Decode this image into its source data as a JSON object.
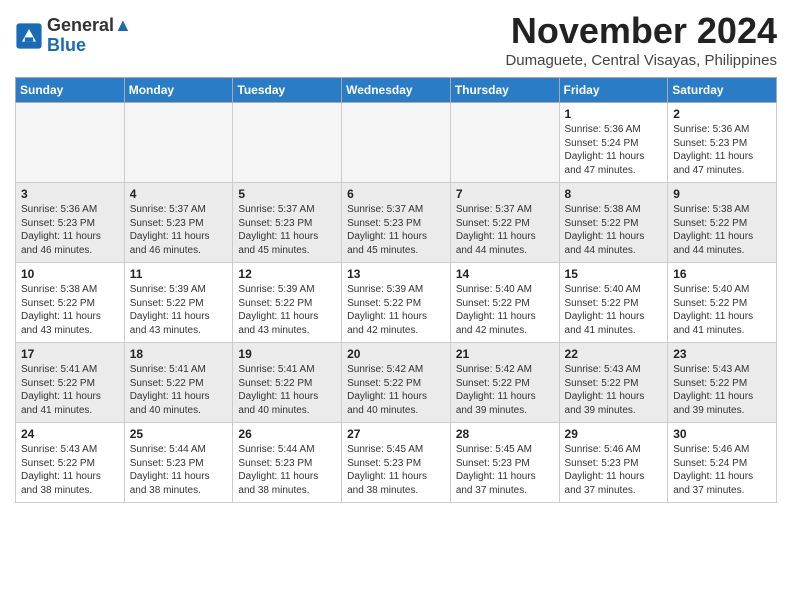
{
  "logo": {
    "line1": "General",
    "line2": "Blue"
  },
  "title": "November 2024",
  "location": "Dumaguete, Central Visayas, Philippines",
  "weekdays": [
    "Sunday",
    "Monday",
    "Tuesday",
    "Wednesday",
    "Thursday",
    "Friday",
    "Saturday"
  ],
  "weeks": [
    [
      {
        "day": "",
        "info": ""
      },
      {
        "day": "",
        "info": ""
      },
      {
        "day": "",
        "info": ""
      },
      {
        "day": "",
        "info": ""
      },
      {
        "day": "",
        "info": ""
      },
      {
        "day": "1",
        "info": "Sunrise: 5:36 AM\nSunset: 5:24 PM\nDaylight: 11 hours\nand 47 minutes."
      },
      {
        "day": "2",
        "info": "Sunrise: 5:36 AM\nSunset: 5:23 PM\nDaylight: 11 hours\nand 47 minutes."
      }
    ],
    [
      {
        "day": "3",
        "info": "Sunrise: 5:36 AM\nSunset: 5:23 PM\nDaylight: 11 hours\nand 46 minutes."
      },
      {
        "day": "4",
        "info": "Sunrise: 5:37 AM\nSunset: 5:23 PM\nDaylight: 11 hours\nand 46 minutes."
      },
      {
        "day": "5",
        "info": "Sunrise: 5:37 AM\nSunset: 5:23 PM\nDaylight: 11 hours\nand 45 minutes."
      },
      {
        "day": "6",
        "info": "Sunrise: 5:37 AM\nSunset: 5:23 PM\nDaylight: 11 hours\nand 45 minutes."
      },
      {
        "day": "7",
        "info": "Sunrise: 5:37 AM\nSunset: 5:22 PM\nDaylight: 11 hours\nand 44 minutes."
      },
      {
        "day": "8",
        "info": "Sunrise: 5:38 AM\nSunset: 5:22 PM\nDaylight: 11 hours\nand 44 minutes."
      },
      {
        "day": "9",
        "info": "Sunrise: 5:38 AM\nSunset: 5:22 PM\nDaylight: 11 hours\nand 44 minutes."
      }
    ],
    [
      {
        "day": "10",
        "info": "Sunrise: 5:38 AM\nSunset: 5:22 PM\nDaylight: 11 hours\nand 43 minutes."
      },
      {
        "day": "11",
        "info": "Sunrise: 5:39 AM\nSunset: 5:22 PM\nDaylight: 11 hours\nand 43 minutes."
      },
      {
        "day": "12",
        "info": "Sunrise: 5:39 AM\nSunset: 5:22 PM\nDaylight: 11 hours\nand 43 minutes."
      },
      {
        "day": "13",
        "info": "Sunrise: 5:39 AM\nSunset: 5:22 PM\nDaylight: 11 hours\nand 42 minutes."
      },
      {
        "day": "14",
        "info": "Sunrise: 5:40 AM\nSunset: 5:22 PM\nDaylight: 11 hours\nand 42 minutes."
      },
      {
        "day": "15",
        "info": "Sunrise: 5:40 AM\nSunset: 5:22 PM\nDaylight: 11 hours\nand 41 minutes."
      },
      {
        "day": "16",
        "info": "Sunrise: 5:40 AM\nSunset: 5:22 PM\nDaylight: 11 hours\nand 41 minutes."
      }
    ],
    [
      {
        "day": "17",
        "info": "Sunrise: 5:41 AM\nSunset: 5:22 PM\nDaylight: 11 hours\nand 41 minutes."
      },
      {
        "day": "18",
        "info": "Sunrise: 5:41 AM\nSunset: 5:22 PM\nDaylight: 11 hours\nand 40 minutes."
      },
      {
        "day": "19",
        "info": "Sunrise: 5:41 AM\nSunset: 5:22 PM\nDaylight: 11 hours\nand 40 minutes."
      },
      {
        "day": "20",
        "info": "Sunrise: 5:42 AM\nSunset: 5:22 PM\nDaylight: 11 hours\nand 40 minutes."
      },
      {
        "day": "21",
        "info": "Sunrise: 5:42 AM\nSunset: 5:22 PM\nDaylight: 11 hours\nand 39 minutes."
      },
      {
        "day": "22",
        "info": "Sunrise: 5:43 AM\nSunset: 5:22 PM\nDaylight: 11 hours\nand 39 minutes."
      },
      {
        "day": "23",
        "info": "Sunrise: 5:43 AM\nSunset: 5:22 PM\nDaylight: 11 hours\nand 39 minutes."
      }
    ],
    [
      {
        "day": "24",
        "info": "Sunrise: 5:43 AM\nSunset: 5:22 PM\nDaylight: 11 hours\nand 38 minutes."
      },
      {
        "day": "25",
        "info": "Sunrise: 5:44 AM\nSunset: 5:23 PM\nDaylight: 11 hours\nand 38 minutes."
      },
      {
        "day": "26",
        "info": "Sunrise: 5:44 AM\nSunset: 5:23 PM\nDaylight: 11 hours\nand 38 minutes."
      },
      {
        "day": "27",
        "info": "Sunrise: 5:45 AM\nSunset: 5:23 PM\nDaylight: 11 hours\nand 38 minutes."
      },
      {
        "day": "28",
        "info": "Sunrise: 5:45 AM\nSunset: 5:23 PM\nDaylight: 11 hours\nand 37 minutes."
      },
      {
        "day": "29",
        "info": "Sunrise: 5:46 AM\nSunset: 5:23 PM\nDaylight: 11 hours\nand 37 minutes."
      },
      {
        "day": "30",
        "info": "Sunrise: 5:46 AM\nSunset: 5:24 PM\nDaylight: 11 hours\nand 37 minutes."
      }
    ]
  ]
}
